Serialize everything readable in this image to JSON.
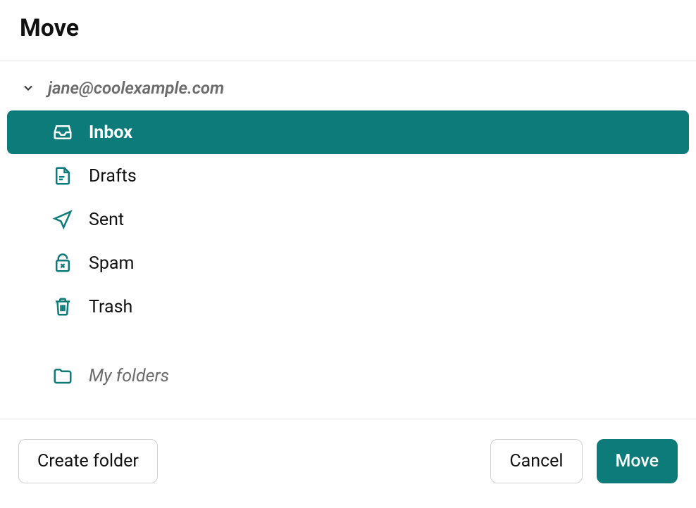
{
  "dialog": {
    "title": "Move"
  },
  "account": {
    "email": "jane@coolexample.com"
  },
  "folders": [
    {
      "id": "inbox",
      "label": "Inbox",
      "icon": "inbox-icon",
      "selected": true
    },
    {
      "id": "drafts",
      "label": "Drafts",
      "icon": "document-icon",
      "selected": false
    },
    {
      "id": "sent",
      "label": "Sent",
      "icon": "paperplane-icon",
      "selected": false
    },
    {
      "id": "spam",
      "label": "Spam",
      "icon": "spam-icon",
      "selected": false
    },
    {
      "id": "trash",
      "label": "Trash",
      "icon": "trash-icon",
      "selected": false
    }
  ],
  "custom_section": {
    "label": "My folders"
  },
  "buttons": {
    "create_folder": "Create folder",
    "cancel": "Cancel",
    "move": "Move"
  },
  "colors": {
    "accent": "#0d7b79",
    "muted_text": "#6b6b6b",
    "divider": "#e5e5e5"
  }
}
